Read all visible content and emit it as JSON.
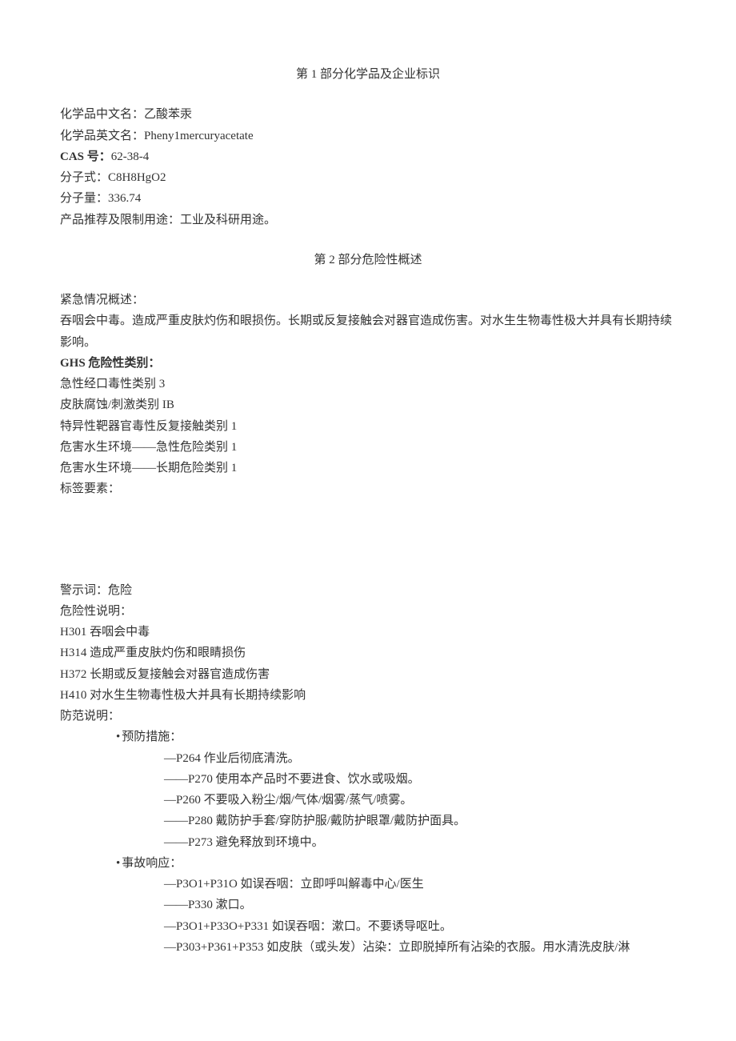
{
  "section1": {
    "title": "第 1 部分化学品及企业标识",
    "fields": {
      "name_cn_label": "化学品中文名：",
      "name_cn": "乙酸苯汞",
      "name_en_label": "化学品英文名：",
      "name_en": "Pheny1mercuryacetate",
      "cas_label": "CAS 号：",
      "cas": "62-38-4",
      "formula_label": "分子式：",
      "formula": "C8H8HgO2",
      "mw_label": "分子量：",
      "mw": "336.74",
      "use_label": "产品推荐及限制用途：",
      "use": "工业及科研用途。"
    }
  },
  "section2": {
    "title": "第 2 部分危险性概述",
    "emergency_label": "紧急情况概述：",
    "emergency_text": "吞咽会中毒。造成严重皮肤灼伤和眼损伤。长期或反复接触会对器官造成伤害。对水生生物毒性极大并具有长期持续影响。",
    "ghs_label": "GHS 危险性类别：",
    "ghs_lines": [
      "急性经口毒性类别 3",
      "皮肤腐蚀/刺激类别 IB",
      "特异性靶器官毒性反复接触类别 1",
      "危害水生环境——急性危险类别 1",
      "危害水生环境——长期危险类别 1"
    ],
    "label_elements_label": "标签要素：",
    "signal_label": "警示词：",
    "signal": "危险",
    "hazard_label": "危险性说明：",
    "hazard_lines": [
      "H301 吞咽会中毒",
      "H314 造成严重皮肤灼伤和眼睛损伤",
      "H372 长期或反复接触会对器官造成伤害",
      "H410 对水生生物毒性极大并具有长期持续影响"
    ],
    "precaution_label": "防范说明：",
    "prevention_label": "预防措施：",
    "prevention_lines": [
      "—P264 作业后彻底清洗。",
      "——P270 使用本产品时不要进食、饮水或吸烟。",
      "—P260 不要吸入粉尘/烟/气体/烟雾/蒸气/喷雾。",
      "——P280 戴防护手套/穿防护服/戴防护眼罩/戴防护面具。",
      "——P273 避免释放到环境中。"
    ],
    "response_label": "事故响应：",
    "response_lines": [
      "—P3O1+P31O 如误吞咽：立即呼叫解毒中心/医生",
      "——P330 漱口。",
      "—P3O1+P33O+P331 如误吞咽：漱口。不要诱导呕吐。",
      "—P303+P361+P353 如皮肤（或头发）沾染：立即脱掉所有沾染的衣服。用水清洗皮肤/淋"
    ]
  }
}
